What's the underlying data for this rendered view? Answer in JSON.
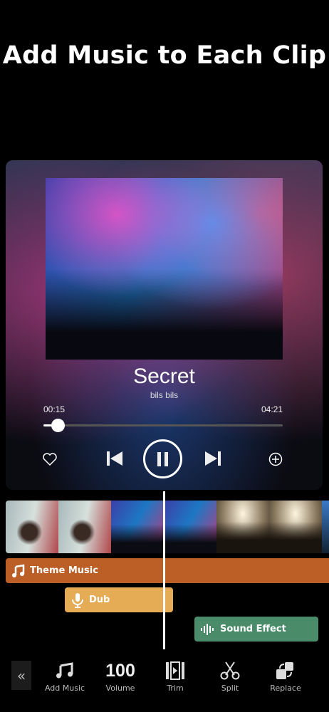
{
  "headline": "Add Music to Each Clip",
  "player": {
    "title": "Secret",
    "artist": "bils bils",
    "elapsed": "00:15",
    "duration": "04:21",
    "progress_percent": 6
  },
  "tracks": {
    "theme": "Theme Music",
    "dub": "Dub",
    "sfx": "Sound Effect"
  },
  "colors": {
    "theme": "#bb5f27",
    "dub": "#e5ac55",
    "sfx": "#4a8c6a"
  },
  "toolbar": {
    "add_music": "Add Music",
    "volume_value": "100",
    "volume": "Volume",
    "trim": "Trim",
    "split": "Split",
    "replace": "Replace"
  }
}
